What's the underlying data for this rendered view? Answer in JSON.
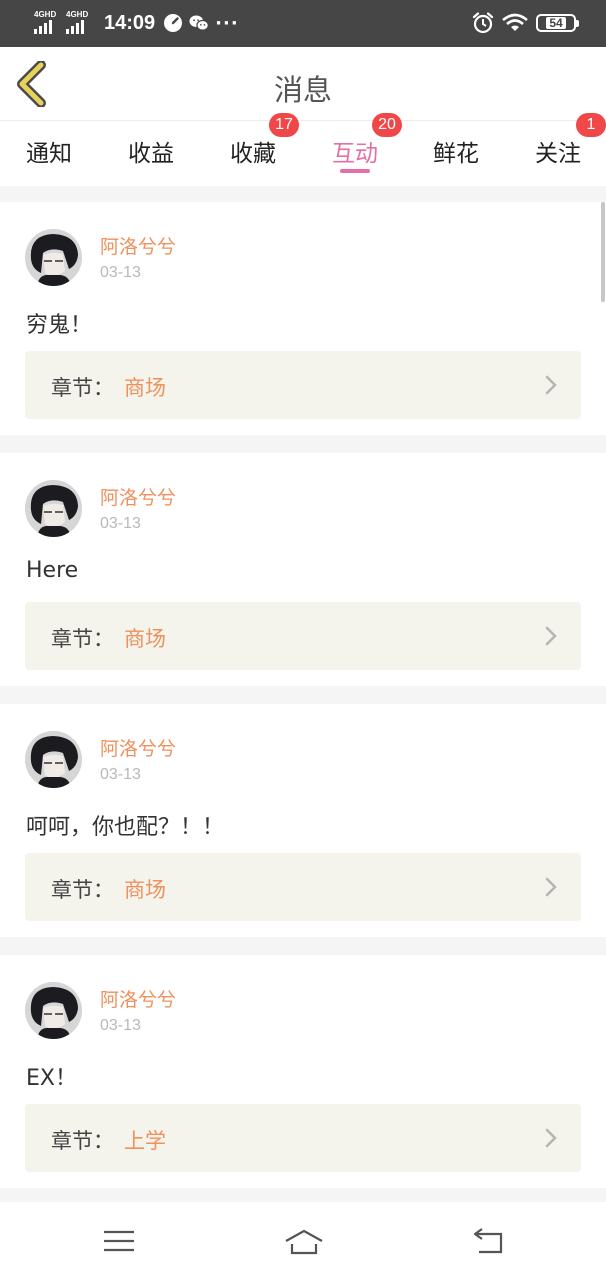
{
  "status_bar": {
    "net1": "4GHD",
    "net2": "4GHD",
    "time": "14:09",
    "more": "···",
    "battery": "54",
    "icons": [
      "signal-icon",
      "signal-icon",
      "speed-icon",
      "wechat-icon",
      "alarm-icon",
      "wifi-icon",
      "battery-icon"
    ]
  },
  "header": {
    "title": "消息",
    "back_icon": "back-arrow-icon"
  },
  "tabs": [
    {
      "label": "通知",
      "badge": ""
    },
    {
      "label": "收益",
      "badge": ""
    },
    {
      "label": "收藏",
      "badge": "17"
    },
    {
      "label": "互动",
      "badge": "20",
      "active": true
    },
    {
      "label": "鲜花",
      "badge": ""
    },
    {
      "label": "关注",
      "badge": "1"
    }
  ],
  "messages": [
    {
      "user": "阿洛兮兮",
      "date": "03-13",
      "text": "穷鬼！",
      "chapter_label": "章节：",
      "chapter": "商场"
    },
    {
      "user": "阿洛兮兮",
      "date": "03-13",
      "text": "Here",
      "chapter_label": "章节：",
      "chapter": "商场"
    },
    {
      "user": "阿洛兮兮",
      "date": "03-13",
      "text": "呵呵，你也配？！！",
      "chapter_label": "章节：",
      "chapter": "商场"
    },
    {
      "user": "阿洛兮兮",
      "date": "03-13",
      "text": "EX！",
      "chapter_label": "章节：",
      "chapter": "上学"
    }
  ],
  "nav_bar": {
    "icons": [
      "menu-icon",
      "home-icon",
      "back-icon"
    ]
  },
  "colors": {
    "accent_pink": "#e56fa5",
    "username_orange": "#ee915c",
    "badge_red": "#f04848",
    "back_arrow_yellow": "#e8d25a",
    "chapter_bg": "#f4f4ec"
  }
}
